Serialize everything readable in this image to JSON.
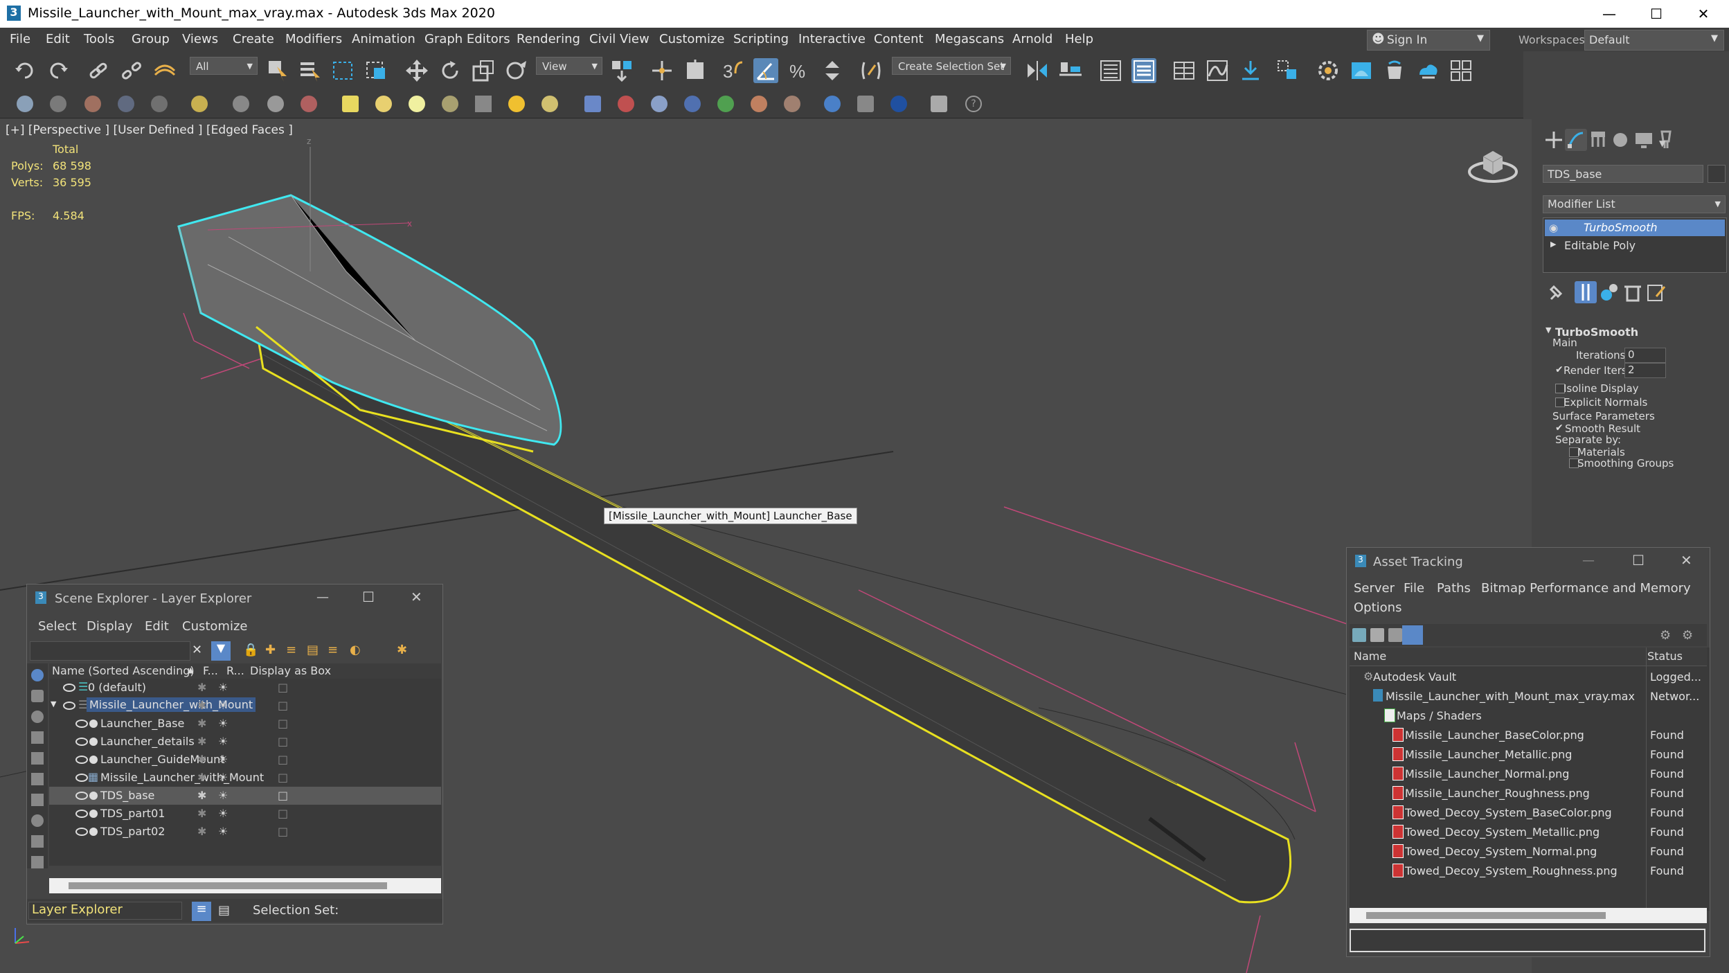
{
  "window": {
    "title": "Missile_Launcher_with_Mount_max_vray.max - Autodesk 3ds Max 2020"
  },
  "menu": [
    "File",
    "Edit",
    "Tools",
    "Group",
    "Views",
    "Create",
    "Modifiers",
    "Animation",
    "Graph Editors",
    "Rendering",
    "Civil View",
    "Customize",
    "Scripting",
    "Interactive",
    "Content",
    "Megascans",
    "Arnold",
    "Help"
  ],
  "account": {
    "sign_in": "Sign In",
    "workspaces_label": "Workspaces:",
    "workspace": "Default"
  },
  "toolbar": {
    "filter": "All",
    "ref_coord": "View",
    "selection_set": "Create Selection Set"
  },
  "viewport": {
    "label": "[+] [Perspective ] [User Defined ] [Edged Faces ]",
    "stats_header": "Total",
    "polys_label": "Polys:",
    "polys": "68 598",
    "verts_label": "Verts:",
    "verts": "36 595",
    "fps_label": "FPS:",
    "fps": "4.584",
    "tooltip": "[Missile_Launcher_with_Mount] Launcher_Base"
  },
  "command_panel": {
    "object_name": "TDS_base",
    "modifier_list": "Modifier List",
    "stack": [
      "TurboSmooth",
      "Editable Poly"
    ],
    "rollout_title": "TurboSmooth",
    "main": "Main",
    "iterations_label": "Iterations:",
    "iterations": "0",
    "render_iters_label": "Render Iters:",
    "render_iters": "2",
    "isoline": "Isoline Display",
    "explicit": "Explicit Normals",
    "surface": "Surface Parameters",
    "smooth_result": "Smooth Result",
    "separate_by": "Separate by:",
    "materials": "Materials",
    "smoothing_groups": "Smoothing Groups"
  },
  "scene_explorer": {
    "title": "Scene Explorer - Layer Explorer",
    "menu": [
      "Select",
      "Display",
      "Edit",
      "Customize"
    ],
    "columns": [
      "Name (Sorted Ascending)",
      "F...",
      "R...",
      "Display as Box"
    ],
    "rows": [
      {
        "name": "0 (default)",
        "level": 0
      },
      {
        "name": "Missile_Launcher_with_Mount",
        "level": 0
      },
      {
        "name": "Launcher_Base",
        "level": 1
      },
      {
        "name": "Launcher_details",
        "level": 1
      },
      {
        "name": "Launcher_GuideMount",
        "level": 1
      },
      {
        "name": "Missile_Launcher_with_Mount",
        "level": 1
      },
      {
        "name": "TDS_base",
        "level": 1
      },
      {
        "name": "TDS_part01",
        "level": 1
      },
      {
        "name": "TDS_part02",
        "level": 1
      }
    ],
    "footer_explorer": "Layer Explorer",
    "footer_selset": "Selection Set:"
  },
  "asset_tracking": {
    "title": "Asset Tracking",
    "menu": [
      "Server",
      "File",
      "Paths",
      "Bitmap Performance and Memory",
      "Options"
    ],
    "columns": [
      "Name",
      "Status"
    ],
    "rows": [
      {
        "name": "Autodesk Vault",
        "status": "Logged...",
        "level": 0
      },
      {
        "name": "Missile_Launcher_with_Mount_max_vray.max",
        "status": "Networ...",
        "level": 1
      },
      {
        "name": "Maps / Shaders",
        "status": "",
        "level": 2
      },
      {
        "name": "Missile_Launcher_BaseColor.png",
        "status": "Found",
        "level": 3
      },
      {
        "name": "Missile_Launcher_Metallic.png",
        "status": "Found",
        "level": 3
      },
      {
        "name": "Missile_Launcher_Normal.png",
        "status": "Found",
        "level": 3
      },
      {
        "name": "Missile_Launcher_Roughness.png",
        "status": "Found",
        "level": 3
      },
      {
        "name": "Towed_Decoy_System_BaseColor.png",
        "status": "Found",
        "level": 3
      },
      {
        "name": "Towed_Decoy_System_Metallic.png",
        "status": "Found",
        "level": 3
      },
      {
        "name": "Towed_Decoy_System_Normal.png",
        "status": "Found",
        "level": 3
      },
      {
        "name": "Towed_Decoy_System_Roughness.png",
        "status": "Found",
        "level": 3
      }
    ]
  }
}
